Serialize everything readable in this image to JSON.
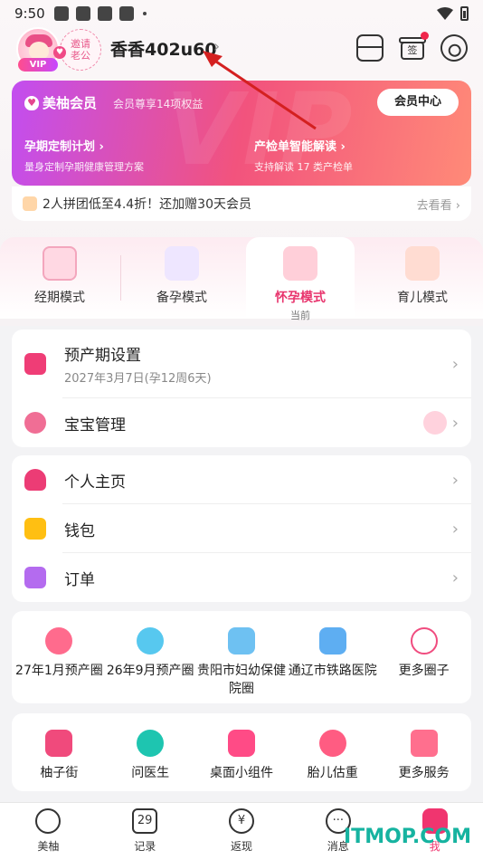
{
  "status": {
    "time": "9:50"
  },
  "header": {
    "username": "香香402u60",
    "invite_text_1": "邀请",
    "invite_text_2": "老公",
    "vip_badge": "VIP"
  },
  "vip": {
    "title": "美柚会员",
    "subtitle": "会员尊享14项权益",
    "center_button": "会员中心",
    "feature1_title": "孕期定制计划",
    "feature1_desc": "量身定制孕期健康管理方案",
    "feature2_title": "产检单智能解读",
    "feature2_desc": "支持解读 17 类产检单"
  },
  "promo": {
    "text": "2人拼团低至4.4折！还加赠30天会员",
    "action": "去看看"
  },
  "modes": [
    {
      "label": "经期模式"
    },
    {
      "label": "备孕模式"
    },
    {
      "label": "怀孕模式",
      "tag": "当前"
    },
    {
      "label": "育儿模式"
    }
  ],
  "card1": {
    "due_title": "预产期设置",
    "due_date": "2027年3月7日(孕12周6天)",
    "baby_label": "宝宝管理"
  },
  "card2": {
    "items": [
      "个人主页",
      "钱包",
      "订单"
    ]
  },
  "circles": [
    {
      "label": "27年1月预产圈",
      "icon": "1"
    },
    {
      "label": "26年9月预产圈",
      "icon": "9"
    },
    {
      "label": "贵阳市妇幼保健院圈"
    },
    {
      "label": "通辽市铁路医院"
    },
    {
      "label": "更多圈子"
    }
  ],
  "services": [
    {
      "label": "柚子街"
    },
    {
      "label": "问医生"
    },
    {
      "label": "桌面小组件"
    },
    {
      "label": "胎儿估重"
    },
    {
      "label": "更多服务"
    }
  ],
  "nav": [
    {
      "label": "美柚",
      "icon": ""
    },
    {
      "label": "记录",
      "icon": "29"
    },
    {
      "label": "返现",
      "icon": "¥"
    },
    {
      "label": "消息",
      "icon": "···"
    },
    {
      "label": "我",
      "icon": ""
    }
  ],
  "watermark": "ITMOP.COM"
}
